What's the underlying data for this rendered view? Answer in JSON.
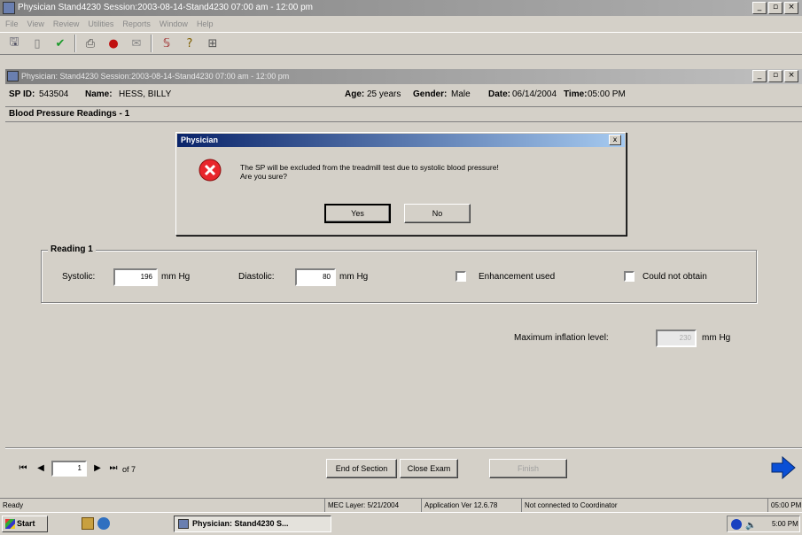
{
  "app": {
    "title": "Physician Stand4230 Session:2003-08-14-Stand4230 07:00 am - 12:00 pm",
    "menu": [
      "File",
      "View",
      "Review",
      "Utilities",
      "Reports",
      "Window",
      "Help"
    ]
  },
  "inner": {
    "title": "Physician: Stand4230 Session:2003-08-14-Stand4230 07:00 am - 12:00 pm"
  },
  "sp": {
    "id_label": "SP ID:",
    "id": "543504",
    "name_label": "Name:",
    "name": "HESS, BILLY",
    "age_label": "Age:",
    "age": "25 years",
    "gender_label": "Gender:",
    "gender": "Male",
    "date_label": "Date:",
    "date": "06/14/2004",
    "time_label": "Time:",
    "time": "05:00 PM"
  },
  "section": {
    "title": "Blood Pressure Readings - 1"
  },
  "reading": {
    "legend": "Reading 1",
    "systolic_label": "Systolic:",
    "systolic_value": "196",
    "unit": "mm Hg",
    "diastolic_label": "Diastolic:",
    "diastolic_value": "80",
    "enhancement_label": "Enhancement used",
    "could_not_obtain_label": "Could not obtain",
    "max_inflation_label": "Maximum inflation level:",
    "max_inflation_value": "230",
    "max_inflation_unit": "mm Hg"
  },
  "dialog": {
    "title": "Physician",
    "close": "x",
    "line1": "The SP will be excluded from the treadmill test due to systolic blood pressure!",
    "line2": "Are you sure?",
    "yes": "Yes",
    "no": "No"
  },
  "nav": {
    "page": "1",
    "of": "of 7",
    "end_of_section": "End of Section",
    "close_exam": "Close Exam",
    "third_button": "Finish"
  },
  "status": {
    "ready": "Ready",
    "mec_layer": "MEC Layer: 5/21/2004",
    "app_version": "Application Ver 12.6.78",
    "coordinator": "Not connected to Coordinator",
    "time": "05:00 PM"
  },
  "taskbar": {
    "start": "Start",
    "task": "Physician: Stand4230 S...",
    "clock": "5:00 PM"
  },
  "colors": {
    "error_red": "#e8262c",
    "nav_blue": "#0a4fd6",
    "title_blue": "#0a246a"
  }
}
